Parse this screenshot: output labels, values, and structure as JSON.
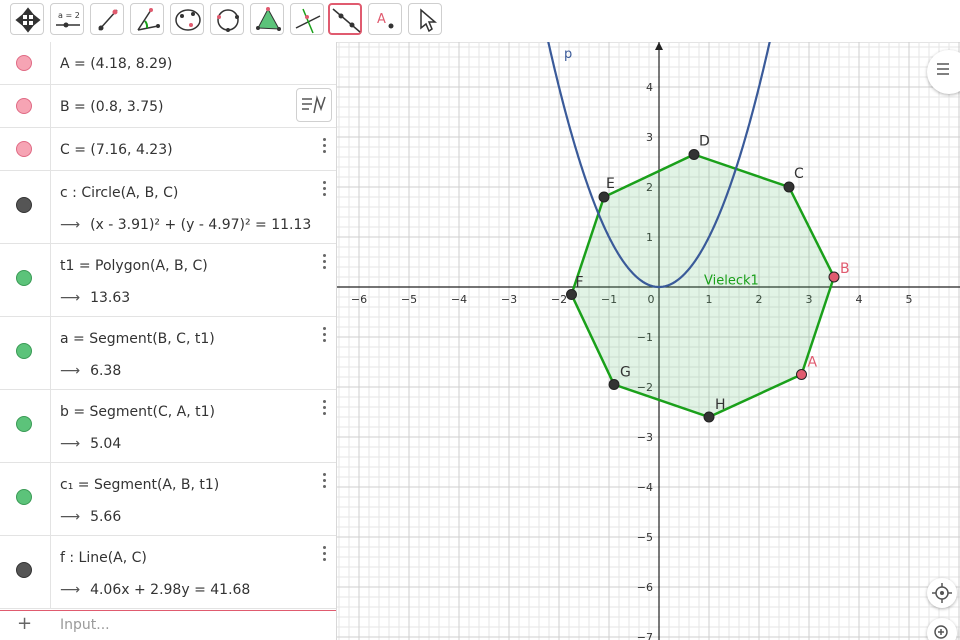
{
  "toolbar": {
    "tools": [
      {
        "name": "move-tool"
      },
      {
        "name": "slider-tool",
        "label": "a = 2"
      },
      {
        "name": "segment-tool"
      },
      {
        "name": "angle-tool"
      },
      {
        "name": "conic-five-points-tool"
      },
      {
        "name": "circle-three-points-tool"
      },
      {
        "name": "polygon-tool"
      },
      {
        "name": "perpendicular-line-tool"
      },
      {
        "name": "line-tool"
      },
      {
        "name": "text-tool",
        "label": "A"
      },
      {
        "name": "select-tool"
      }
    ]
  },
  "algebra": {
    "rows": [
      {
        "def": "A = (4.18, 8.29)",
        "value": "",
        "marble": "#f6a4b4"
      },
      {
        "def": "B = (0.8, 3.75)",
        "value": "",
        "marble": "#f6a4b4"
      },
      {
        "def": "C = (7.16, 4.23)",
        "value": "",
        "marble": "#f6a4b4"
      },
      {
        "def": "c : Circle(A, B, C)",
        "value": "(x - 3.91)² + (y - 4.97)² = 11.13",
        "marble": "#555555"
      },
      {
        "def": "t1 = Polygon(A, B, C)",
        "value": "13.63",
        "marble": "#5cc37a"
      },
      {
        "def": "a = Segment(B, C, t1)",
        "value": "6.38",
        "marble": "#5cc37a"
      },
      {
        "def": "b = Segment(C, A, t1)",
        "value": "5.04",
        "marble": "#5cc37a"
      },
      {
        "def": "c₁ = Segment(A, B, t1)",
        "value": "5.66",
        "marble": "#5cc37a"
      },
      {
        "def": "f : Line(A, C)",
        "value": "4.06x + 2.98y = 41.68",
        "marble": "#555555"
      }
    ],
    "arrow": "⟶",
    "input_placeholder": "Input..."
  },
  "graphics": {
    "xticks": [
      "−6",
      "−5",
      "−4",
      "−3",
      "−2",
      "−1",
      "0",
      "1",
      "2",
      "3",
      "4",
      "5"
    ],
    "yticks": [
      "4",
      "3",
      "2",
      "1",
      "−1",
      "−2",
      "−3",
      "−4",
      "−5",
      "−6",
      "−7"
    ],
    "x_range": [
      -6.5,
      6
    ],
    "y_range": [
      -7,
      4.9
    ],
    "parabola_label": "p",
    "polygon_label": "Vieleck1",
    "points": [
      {
        "label": "A",
        "x": 2.85,
        "y": -1.75,
        "color": "#e05b6f"
      },
      {
        "label": "B",
        "x": 3.5,
        "y": 0.2,
        "color": "#e05b6f"
      },
      {
        "label": "C",
        "x": 2.6,
        "y": 2.0,
        "color": "#333333"
      },
      {
        "label": "D",
        "x": 0.7,
        "y": 2.65,
        "color": "#333333"
      },
      {
        "label": "E",
        "x": -1.1,
        "y": 1.8,
        "color": "#333333"
      },
      {
        "label": "F",
        "x": -1.75,
        "y": -0.15,
        "color": "#333333"
      },
      {
        "label": "G",
        "x": -0.9,
        "y": -1.95,
        "color": "#333333"
      },
      {
        "label": "H",
        "x": 1.0,
        "y": -2.6,
        "color": "#333333"
      }
    ],
    "colors": {
      "polygon": "#1aa01a",
      "parabola": "#3a5a99",
      "grid": "#e6e6e6",
      "grid_major": "#cfcfcf",
      "accent": "#e05b6f"
    }
  }
}
